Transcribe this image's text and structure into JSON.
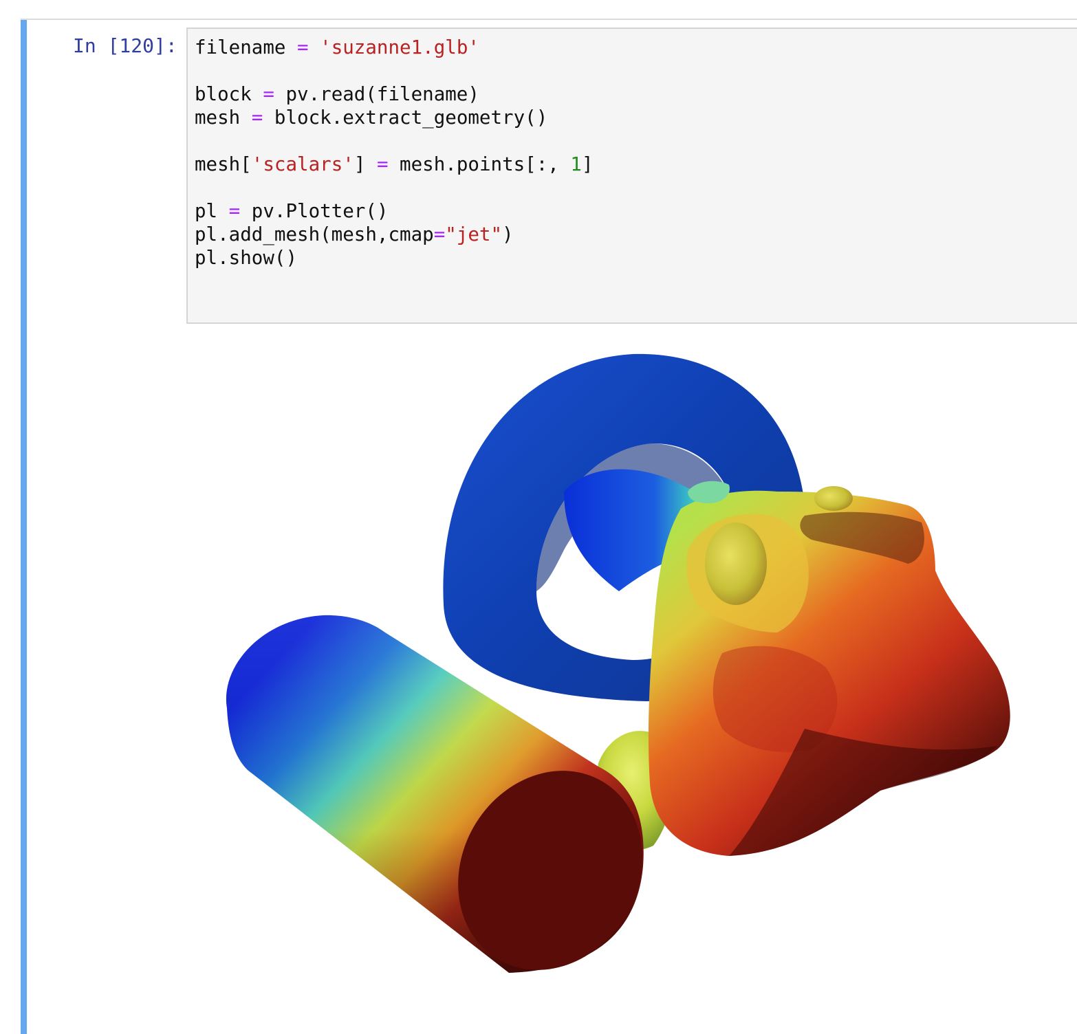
{
  "cell": {
    "prompt": "In [120]:",
    "code_lines": [
      [
        {
          "t": "filename "
        },
        {
          "t": "=",
          "c": "op"
        },
        {
          "t": " "
        },
        {
          "t": "'suzanne1.glb'",
          "c": "str"
        }
      ],
      [],
      [
        {
          "t": "block "
        },
        {
          "t": "=",
          "c": "op"
        },
        {
          "t": " pv.read(filename)"
        }
      ],
      [
        {
          "t": "mesh "
        },
        {
          "t": "=",
          "c": "op"
        },
        {
          "t": " block.extract_geometry()"
        }
      ],
      [],
      [
        {
          "t": "mesh["
        },
        {
          "t": "'scalars'",
          "c": "str"
        },
        {
          "t": "] "
        },
        {
          "t": "=",
          "c": "op"
        },
        {
          "t": " mesh.points[:, "
        },
        {
          "t": "1",
          "c": "num"
        },
        {
          "t": "]"
        }
      ],
      [],
      [
        {
          "t": "pl "
        },
        {
          "t": "=",
          "c": "op"
        },
        {
          "t": " pv.Plotter()"
        }
      ],
      [
        {
          "t": "pl.add_mesh(mesh,cmap"
        },
        {
          "t": "=",
          "c": "op"
        },
        {
          "t": "\"jet\"",
          "c": "str"
        },
        {
          "t": ")"
        }
      ],
      [
        {
          "t": "pl.show()"
        }
      ]
    ]
  },
  "colors": {
    "cell_bar": "#66a7ee",
    "prompt": "#303f9f",
    "operator": "#aa22ff",
    "string": "#ba2121",
    "number": "#238b22"
  },
  "output": {
    "render_objects": [
      "cylinder-mesh",
      "torus-mesh",
      "suzanne-monkey-head-mesh"
    ],
    "colormap": "jet"
  }
}
